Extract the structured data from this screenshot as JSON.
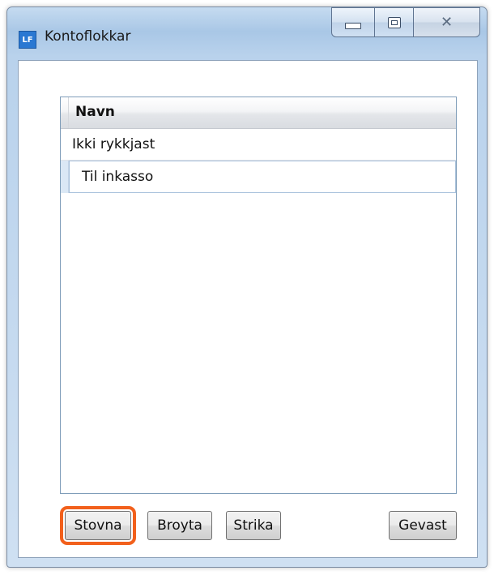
{
  "window": {
    "icon_text": "LF",
    "title": "Kontoflokkar",
    "caption_buttons": {
      "minimize_icon": "minimize-icon",
      "maximize_icon": "maximize-icon",
      "close_glyph": "✕"
    }
  },
  "grid": {
    "column_header": "Navn",
    "rows": [
      {
        "name": "Ikki rykkjast"
      },
      {
        "name": "Til inkasso"
      }
    ]
  },
  "buttons": {
    "new_label": "Stovna",
    "edit_label": "Broyta",
    "delete_label": "Strika",
    "cancel_label": "Gevast"
  },
  "colors": {
    "focus_outline": "#f2601c",
    "selection": "#dbe8f5",
    "app_icon": "#2a78d2"
  }
}
